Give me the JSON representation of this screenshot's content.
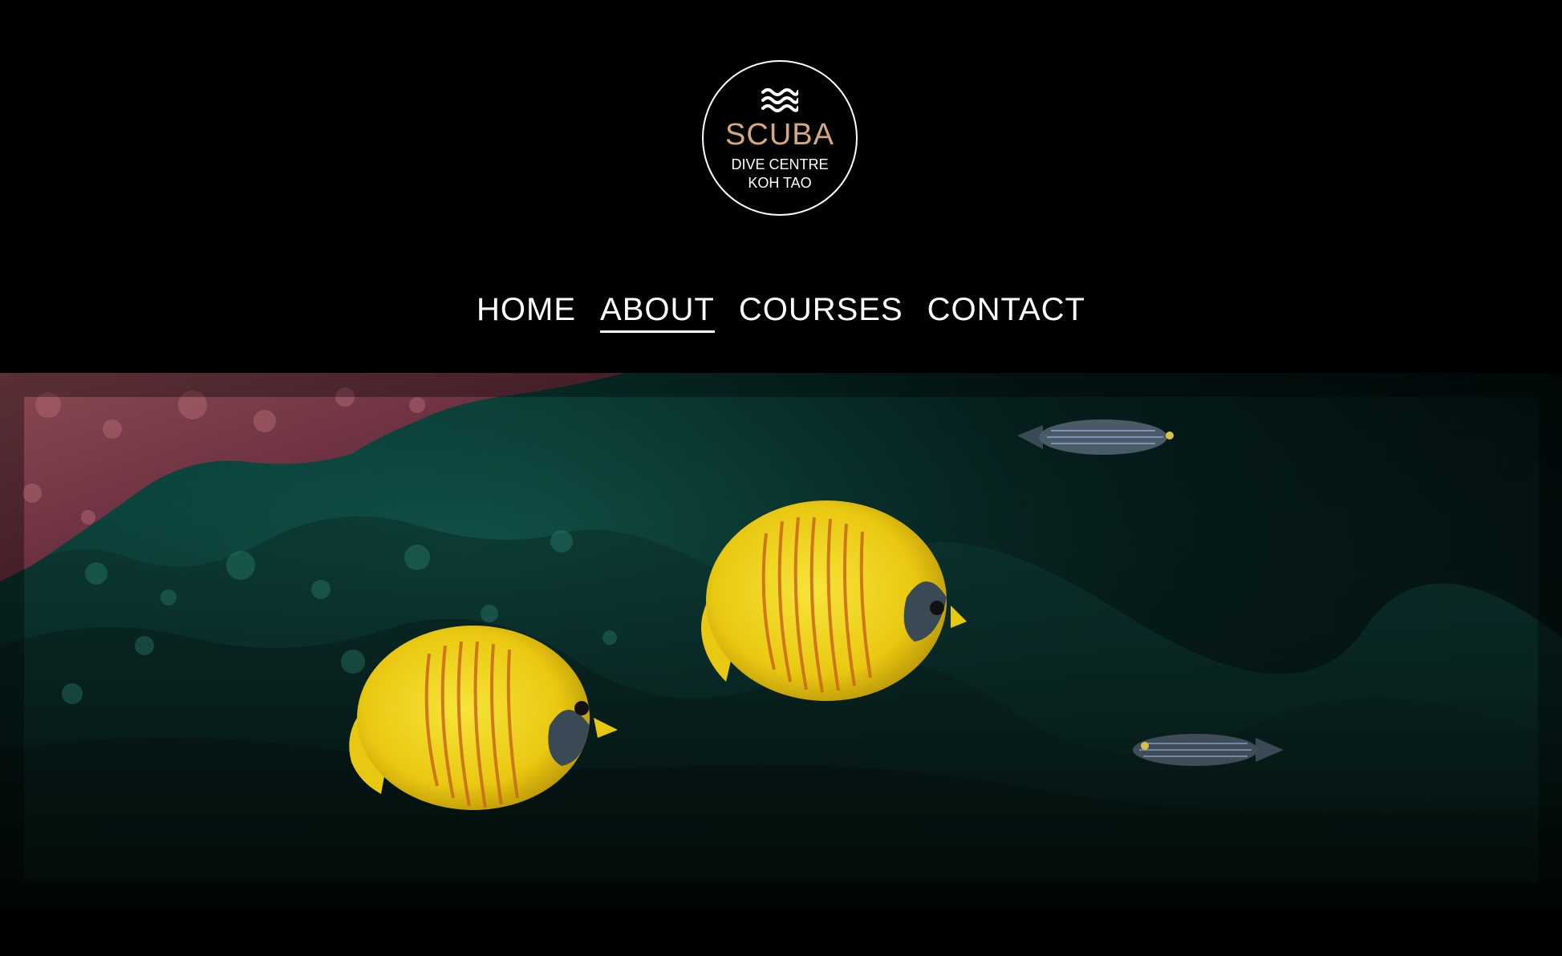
{
  "logo": {
    "icon": "waves-icon",
    "brand": "SCUBA",
    "line1": "DIVE CENTRE",
    "line2": "KOH TAO",
    "brand_color": "#d6a77f"
  },
  "nav": {
    "items": [
      {
        "label": "HOME"
      },
      {
        "label": "ABOUT"
      },
      {
        "label": "COURSES"
      },
      {
        "label": "CONTACT"
      }
    ],
    "active": "ABOUT"
  },
  "colors": {
    "background": "#000000",
    "text": "#ffffff",
    "accent": "#d6a77f"
  }
}
